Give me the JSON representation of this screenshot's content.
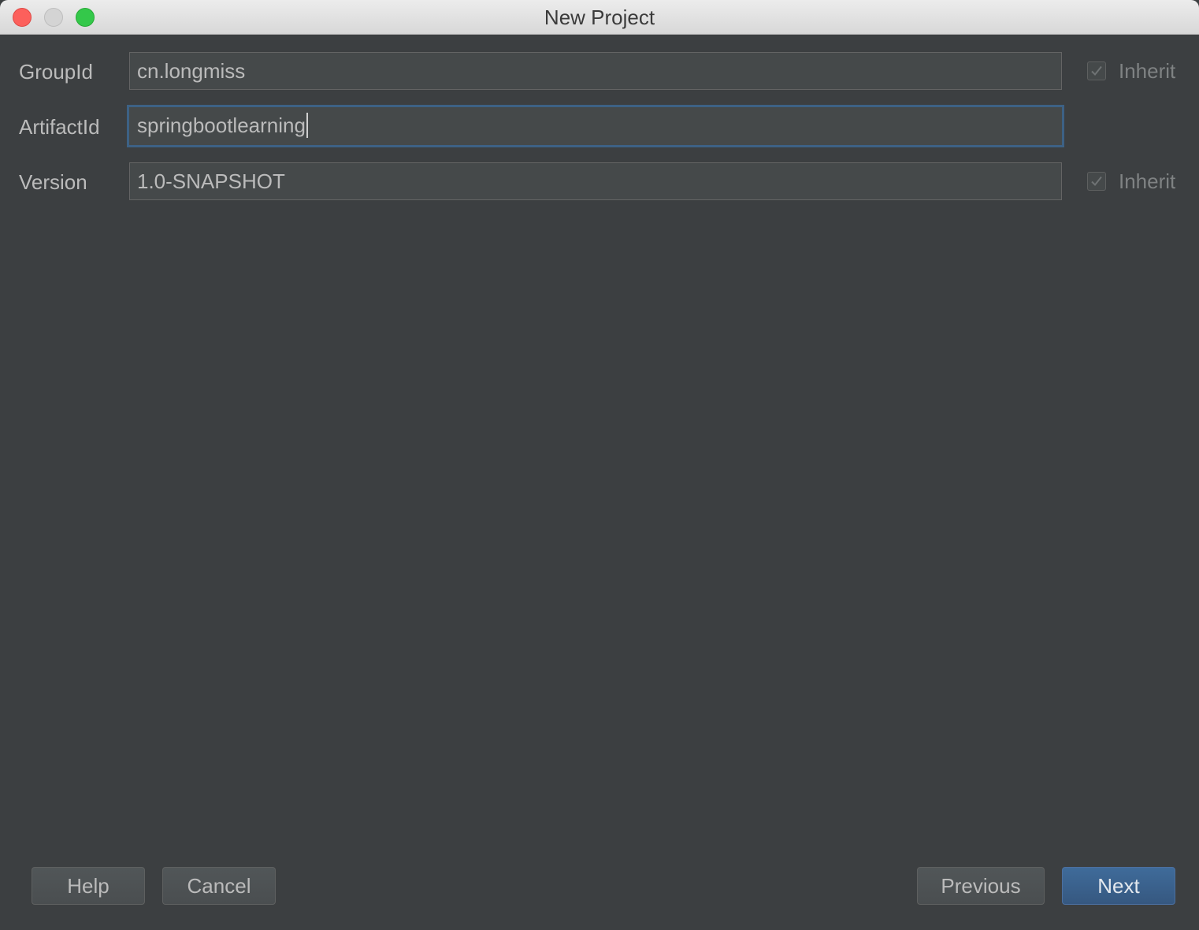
{
  "window": {
    "title": "New Project"
  },
  "form": {
    "group_id": {
      "label": "GroupId",
      "value": "cn.longmiss",
      "inherit_label": "Inherit",
      "inherit_checked": true
    },
    "artifact_id": {
      "label": "ArtifactId",
      "value": "springbootlearning"
    },
    "version": {
      "label": "Version",
      "value": "1.0-SNAPSHOT",
      "inherit_label": "Inherit",
      "inherit_checked": true
    }
  },
  "buttons": {
    "help": "Help",
    "cancel": "Cancel",
    "previous": "Previous",
    "next": "Next"
  },
  "colors": {
    "background": "#3c3f41",
    "field_background": "#45494a",
    "focus_border": "#3d6185",
    "primary_button": "#365880",
    "text": "#bbbbbb"
  }
}
